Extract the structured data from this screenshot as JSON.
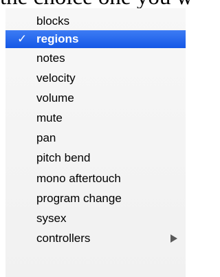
{
  "background_text": "the choice one you wa",
  "menu": {
    "items": [
      {
        "label": "blocks",
        "checked": false
      },
      {
        "label": "regions",
        "checked": true,
        "check_mark": "✓"
      },
      {
        "label": "notes",
        "checked": false
      },
      {
        "label": "velocity",
        "checked": false
      },
      {
        "label": "volume",
        "checked": false
      },
      {
        "label": "mute",
        "checked": false
      },
      {
        "label": "pan",
        "checked": false
      },
      {
        "label": "pitch bend",
        "checked": false
      },
      {
        "label": "mono aftertouch",
        "checked": false
      },
      {
        "label": "program change",
        "checked": false
      },
      {
        "label": "sysex",
        "checked": false
      },
      {
        "label": "controllers",
        "checked": false,
        "has_submenu": true,
        "submenu_icon": "chevron-right-icon"
      }
    ]
  },
  "colors": {
    "selection": "#1d62ee",
    "menu_background": "#f4f4f4",
    "arrow": "#5a5a5a"
  }
}
